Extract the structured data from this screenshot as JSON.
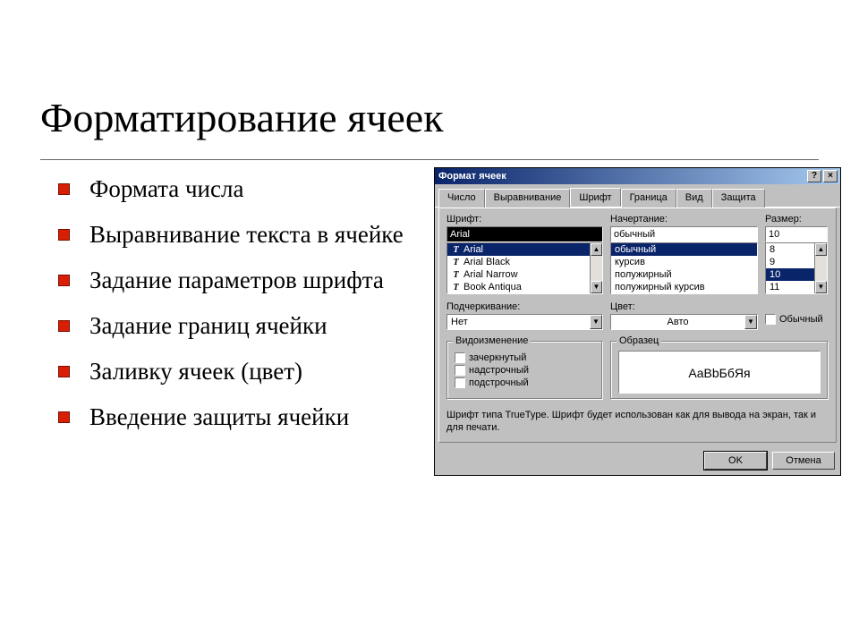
{
  "slide": {
    "title": "Форматирование ячеек",
    "bullets": [
      " Формата числа",
      " Выравнивание текста в ячейке",
      " Задание параметров шрифта",
      " Задание границ ячейки",
      " Заливку ячеек (цвет)",
      " Введение защиты ячейки"
    ]
  },
  "dialog": {
    "title": "Формат ячеек",
    "help": "?",
    "close": "×",
    "tabs": [
      "Число",
      "Выравнивание",
      "Шрифт",
      "Граница",
      "Вид",
      "Защита"
    ],
    "active_tab": 2,
    "font": {
      "label": "Шрифт:",
      "value": "Arial",
      "list": [
        "Arial",
        "Arial Black",
        "Arial Narrow",
        "Book Antiqua"
      ],
      "selected_index": 0
    },
    "style": {
      "label": "Начертание:",
      "value": "обычный",
      "list": [
        "обычный",
        "курсив",
        "полужирный",
        "полужирный курсив"
      ],
      "selected_index": 0
    },
    "size": {
      "label": "Размер:",
      "value": "10",
      "list": [
        "8",
        "9",
        "10",
        "11"
      ],
      "selected_index": 2
    },
    "underline": {
      "label": "Подчеркивание:",
      "value": "Нет"
    },
    "color": {
      "label": "Цвет:",
      "value": "Авто"
    },
    "normal_font": {
      "label": "Обычный"
    },
    "effects": {
      "title": "Видоизменение",
      "strike": "зачеркнутый",
      "sup": "надстрочный",
      "sub": "подстрочный"
    },
    "preview": {
      "title": "Образец",
      "text": "AaBbБбЯя"
    },
    "footnote": "Шрифт типа TrueType. Шрифт будет использован как для вывода на экран, так и для печати.",
    "ok": "OK",
    "cancel": "Отмена"
  }
}
